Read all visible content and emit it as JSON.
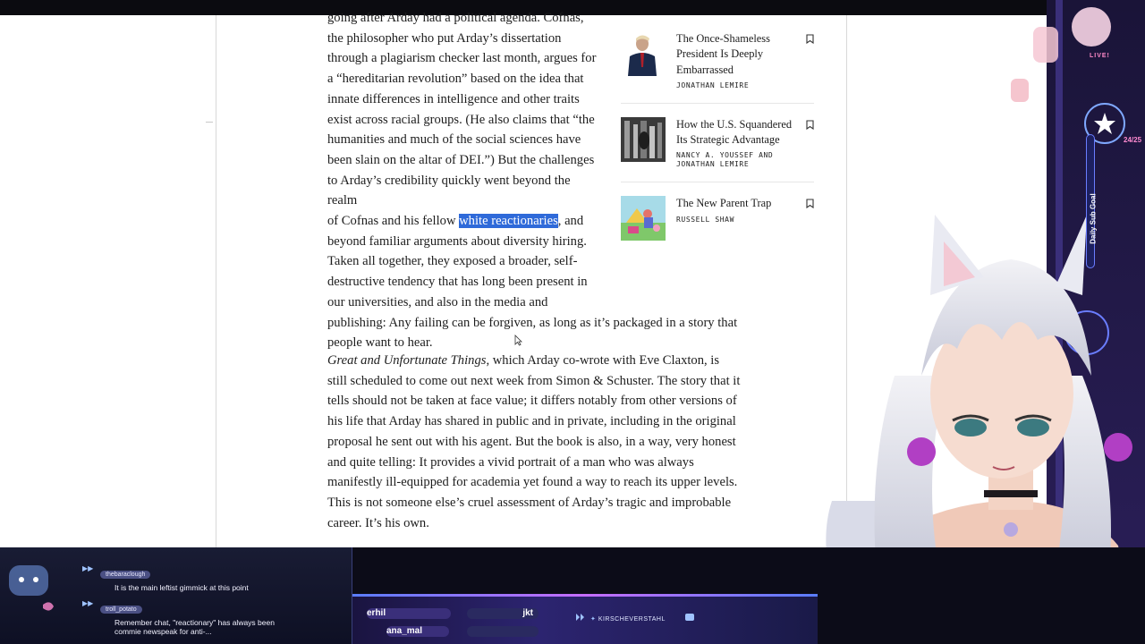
{
  "article": {
    "lines": [
      "going after Arday had a political agenda. Cofnas,",
      "the philosopher who put Arday’s dissertation",
      "through a plagiarism checker last month, argues for",
      "a “hereditarian revolution” based on the idea that",
      "innate differences in intelligence and other traits",
      "exist across racial groups. (He also claims that “the",
      "humanities and much of the social sciences have",
      "been slain on the altar of DEI.”) But the challenges",
      "to Arday’s credibility quickly went beyond the realm"
    ],
    "line_pre_highlight": "of Cofnas and his fellow ",
    "highlight": "white reactionaries",
    "line_post_highlight": ", and",
    "lines_after": [
      "beyond familiar arguments about diversity hiring.",
      "Taken all together, they exposed a broader, self-",
      "destructive tendency that has long been present in",
      "our universities, and also in the media and",
      "publishing: Any failing can be forgiven, as long as it’s packaged in a story that",
      "people want to hear."
    ],
    "para2_italic": "Great and Unfortunate Things",
    "para2_text": ", which Arday co-wrote with Eve Claxton, is still scheduled to come out next week from Simon & Schuster. The story that it tells should not be taken at face value; it differs notably from other versions of his life that Arday has shared in public and in private, including in the original proposal he sent out with his agent. But the book is also, in a way, very honest and quite telling: It provides a vivid portrait of a man who was always manifestly ill-equipped for academia yet found a way to reach its upper levels. This is not someone else’s cruel assessment of Arday’s tragic and improbable career. It’s his own."
  },
  "sidebar": {
    "stories": [
      {
        "title": "The Once-Shameless President Is Deeply Embarrassed",
        "author": "JONATHAN LEMIRE",
        "thumb": "portrait-photo"
      },
      {
        "title": "How the U.S. Squandered Its Strategic Advantage",
        "author": "NANCY A. YOUSSEF AND JONATHAN LEMIRE",
        "thumb": "bw-photo"
      },
      {
        "title": "The New Parent Trap",
        "author": "RUSSELL SHAW",
        "thumb": "illustration"
      }
    ],
    "bookmark_icon": "bookmark-icon"
  },
  "chat": {
    "messages": [
      {
        "user": "thebaraclough",
        "text": "It is the main leftist gimmick at this point"
      },
      {
        "user": "troll_potato",
        "text": "Remember chat, \"reactionary\" has always been commie newspeak for anti-..."
      }
    ]
  },
  "ticker": {
    "names": [
      "erhil",
      "ana_mal",
      "jkt"
    ],
    "social_handle": "KIRSCHEVERSTAHL"
  },
  "overlay": {
    "live_label": "LIVE!",
    "subgoal_label": "Daily Sub Goal",
    "subgoal_count": "24/25"
  },
  "colors": {
    "highlight": "#2f6ad9",
    "stream_purple": "#2c2470",
    "accent_pink": "#ff8ad0"
  }
}
